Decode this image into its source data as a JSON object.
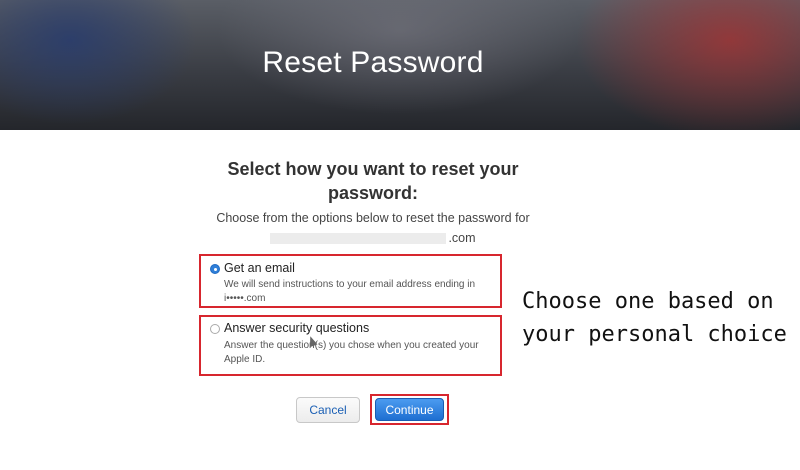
{
  "banner": {
    "title": "Reset Password"
  },
  "main": {
    "heading": "Select how you want to reset your password:",
    "subtext": "Choose from the options below to reset the password for",
    "email_domain": ".com"
  },
  "options": [
    {
      "label": "Get an email",
      "description": "We will send instructions to your email address ending in i•••••.com",
      "selected": true
    },
    {
      "label": "Answer security questions",
      "description": "Answer the question(s) you chose when you created your Apple ID.",
      "selected": false
    }
  ],
  "buttons": {
    "cancel": "Cancel",
    "continue": "Continue"
  },
  "annotation": {
    "text": "Choose one based on your personal choice"
  },
  "colors": {
    "highlight": "#d7262e",
    "accent": "#2f7fd8"
  }
}
